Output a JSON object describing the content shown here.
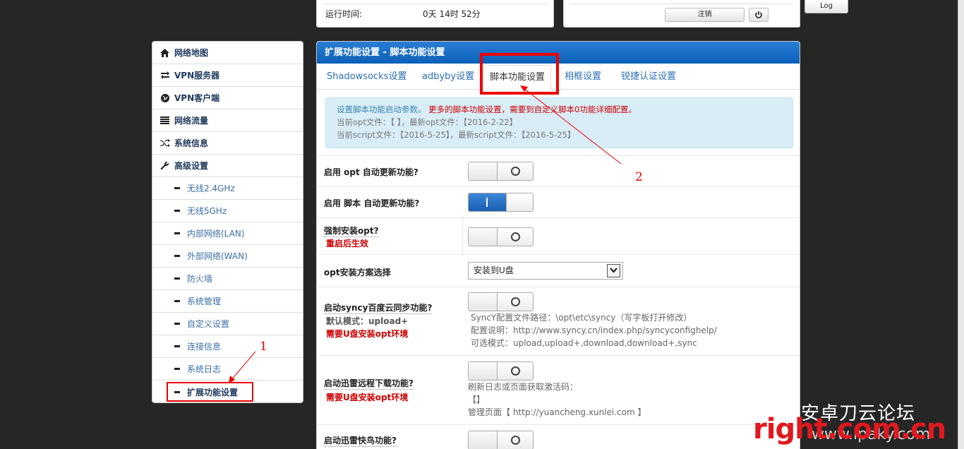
{
  "top": {
    "runtime_label": "运行时间:",
    "runtime_value": "0天 14时 52分",
    "logout_label": "注销",
    "log_label": "Log"
  },
  "sidebar": {
    "items": [
      {
        "label": "网络地图",
        "icon": "home-icon"
      },
      {
        "label": "VPN服务器",
        "icon": "retweet-icon"
      },
      {
        "label": "VPN客户端",
        "icon": "globe-icon"
      },
      {
        "label": "网络流量",
        "icon": "list-icon"
      },
      {
        "label": "系统信息",
        "icon": "shuffle-icon"
      },
      {
        "label": "高级设置",
        "icon": "wrench-icon"
      }
    ],
    "subitems": [
      "无线2.4GHz",
      "无线5GHz",
      "内部网络(LAN)",
      "外部网络(WAN)",
      "防火墙",
      "系统管理",
      "自定义设置",
      "连接信息",
      "系统日志",
      "扩展功能设置"
    ]
  },
  "main": {
    "title": "扩展功能设置 - 脚本功能设置",
    "tabs": [
      "Shadowsocks设置",
      "adbyby设置",
      "脚本功能设置",
      "相框设置",
      "锐捷认证设置"
    ],
    "info": {
      "line1_a": "设置脚本功能启动参数。",
      "line1_b": "更多的脚本功能设置，需要到自定义脚本0功能详细配置。",
      "line2": "当前opt文件：【 】，最新opt文件：【2016-2-22】",
      "line3": "当前script文件：【2016-5-25】，最新script文件：【2016-5-25】"
    },
    "rows": {
      "opt_update": "启用 opt 自动更新功能?",
      "script_update": "启用 脚本 自动更新功能?",
      "force_opt": "强制安装opt?",
      "force_opt_note": "重启后生效",
      "opt_install": "opt安装方案选择",
      "opt_install_value": "安装到U盘",
      "syncy": "启动syncy百度云同步功能?",
      "syncy_note1": "默认模式：upload+",
      "syncy_note2": "需要U盘安装opt环境",
      "syncy_desc1": "SyncY配置文件路径：\\opt\\etc\\syncy（写字板打开修改）",
      "syncy_desc2": "配置说明：http://www.syncy.cn/index.php/syncyconfighelp/",
      "syncy_desc3": "可选模式：upload,upload+,download,download+,sync",
      "xunlei": "启动迅雷远程下载功能?",
      "xunlei_note": "需要U盘安装opt环境",
      "xunlei_desc1": "刷新日志或页面获取激活码：",
      "xunlei_desc2": "【】",
      "xunlei_desc3": "管理页面【 http://yuancheng.xunlei.com 】",
      "kuainiao": "启动迅雷快鸟功能?"
    },
    "toggles": {
      "opt_update": false,
      "script_update": true,
      "force_opt": false,
      "syncy": false,
      "xunlei": false,
      "kuainiao": false
    }
  },
  "annotations": {
    "a1": "1",
    "a2": "2"
  },
  "watermark": {
    "top": "安卓刀云论坛",
    "brand": "right.com.cn",
    "site": "www.ipaky.com"
  },
  "colors": {
    "accent": "#0a5fb8",
    "annotation": "#e00000"
  }
}
